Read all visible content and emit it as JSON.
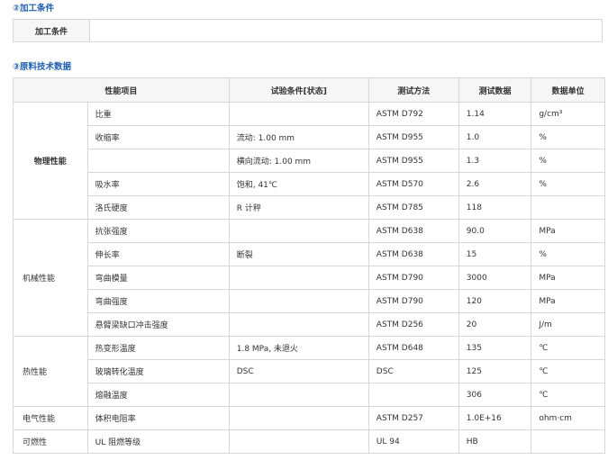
{
  "sections": {
    "processing_title": "②加工条件",
    "data_title": "③原料技术数据"
  },
  "processing": {
    "label": "加工条件",
    "value": ""
  },
  "table": {
    "headers": [
      "性能项目",
      "试验条件[状态]",
      "测试方法",
      "测试数据",
      "数据单位"
    ],
    "groups": [
      {
        "category": "物理性能",
        "rows": [
          {
            "prop": "比重",
            "cond": "",
            "method": "ASTM D792",
            "value": "1.14",
            "unit": "g/cm³"
          },
          {
            "prop": "收缩率",
            "cond": "流动: 1.00 mm",
            "method": "ASTM D955",
            "value": "1.0",
            "unit": "%"
          },
          {
            "prop": "",
            "cond": "横向流动: 1.00 mm",
            "method": "ASTM D955",
            "value": "1.3",
            "unit": "%"
          },
          {
            "prop": "吸水率",
            "cond": "饱和, 41℃",
            "method": "ASTM D570",
            "value": "2.6",
            "unit": "%"
          },
          {
            "prop": "洛氏硬度",
            "cond": "R 计秤",
            "method": "ASTM D785",
            "value": "118",
            "unit": ""
          }
        ]
      },
      {
        "category": "机械性能",
        "rows": [
          {
            "prop": "抗张强度",
            "cond": "",
            "method": "ASTM D638",
            "value": "90.0",
            "unit": "MPa"
          },
          {
            "prop": "伸长率",
            "cond": "断裂",
            "method": "ASTM D638",
            "value": "15",
            "unit": "%"
          },
          {
            "prop": "弯曲模量",
            "cond": "",
            "method": "ASTM D790",
            "value": "3000",
            "unit": "MPa"
          },
          {
            "prop": "弯曲强度",
            "cond": "",
            "method": "ASTM D790",
            "value": "120",
            "unit": "MPa"
          },
          {
            "prop": "悬臂梁缺口冲击强度",
            "cond": "",
            "method": "ASTM D256",
            "value": "20",
            "unit": "J/m"
          }
        ]
      },
      {
        "category": "热性能",
        "rows": [
          {
            "prop": "热变形温度",
            "cond": "1.8 MPa, 未退火",
            "method": "ASTM D648",
            "value": "135",
            "unit": "℃"
          },
          {
            "prop": "玻璃转化温度",
            "cond": "DSC",
            "method": "DSC",
            "value": "125",
            "unit": "℃"
          },
          {
            "prop": "熔融温度",
            "cond": "",
            "method": "",
            "value": "306",
            "unit": "℃"
          }
        ]
      },
      {
        "category": "电气性能",
        "rows": [
          {
            "prop": "体积电阻率",
            "cond": "",
            "method": "ASTM D257",
            "value": "1.0E+16",
            "unit": "ohm·cm"
          }
        ]
      },
      {
        "category": "可燃性",
        "rows": [
          {
            "prop": "UL 阻燃等级",
            "cond": "",
            "method": "UL 94",
            "value": "HB",
            "unit": ""
          }
        ]
      }
    ]
  }
}
